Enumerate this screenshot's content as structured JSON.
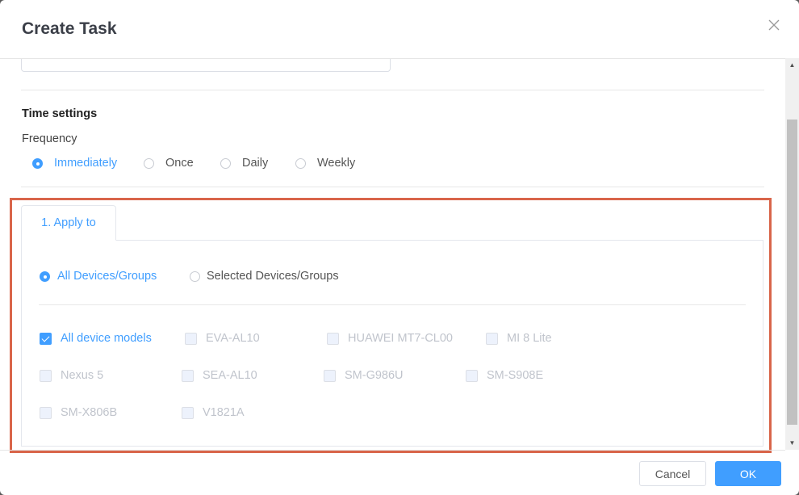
{
  "dialog": {
    "title": "Create Task",
    "close_icon": "close-icon"
  },
  "time_settings": {
    "section_title": "Time settings",
    "frequency_label": "Frequency",
    "frequency_options": [
      {
        "label": "Immediately",
        "selected": true
      },
      {
        "label": "Once",
        "selected": false
      },
      {
        "label": "Daily",
        "selected": false
      },
      {
        "label": "Weekly",
        "selected": false
      }
    ]
  },
  "apply_to": {
    "tab_label": "1. Apply to",
    "scope_options": [
      {
        "label": "All Devices/Groups",
        "selected": true
      },
      {
        "label": "Selected Devices/Groups",
        "selected": false
      }
    ],
    "device_models": [
      {
        "label": "All device models",
        "checked": true,
        "disabled": false
      },
      {
        "label": "EVA-AL10",
        "checked": false,
        "disabled": true
      },
      {
        "label": "HUAWEI MT7-CL00",
        "checked": false,
        "disabled": true
      },
      {
        "label": "MI 8 Lite",
        "checked": false,
        "disabled": true
      },
      {
        "label": "Nexus 5",
        "checked": false,
        "disabled": true
      },
      {
        "label": "SEA-AL10",
        "checked": false,
        "disabled": true
      },
      {
        "label": "SM-G986U",
        "checked": false,
        "disabled": true
      },
      {
        "label": "SM-S908E",
        "checked": false,
        "disabled": true
      },
      {
        "label": "SM-X806B",
        "checked": false,
        "disabled": true
      },
      {
        "label": "V1821A",
        "checked": false,
        "disabled": true
      }
    ]
  },
  "footer": {
    "cancel_label": "Cancel",
    "ok_label": "OK"
  },
  "colors": {
    "accent": "#409eff",
    "highlight_border": "#d9654a",
    "partial_icon": "#f5b400"
  }
}
